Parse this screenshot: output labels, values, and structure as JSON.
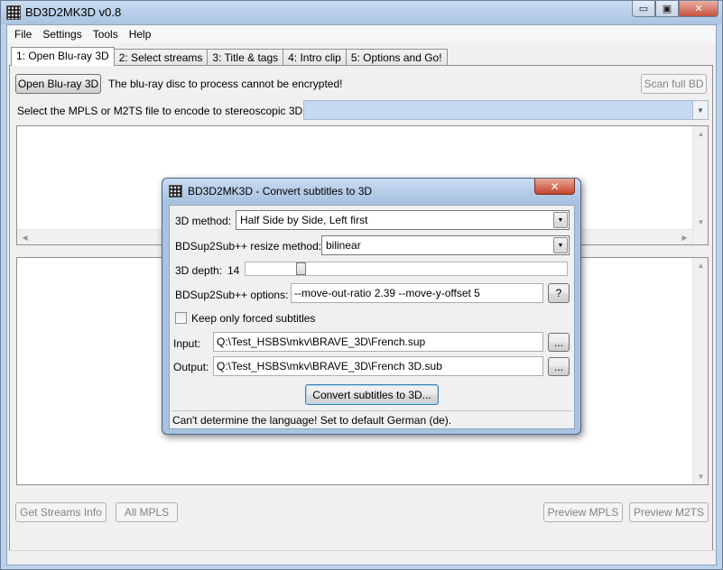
{
  "window": {
    "title": "BD3D2MK3D v0.8",
    "controls": {
      "minimize": "▭",
      "maximize": "▣",
      "close": "✕"
    }
  },
  "menu": [
    "File",
    "Settings",
    "Tools",
    "Help"
  ],
  "tabs": [
    "1: Open Blu-ray 3D",
    "2: Select streams",
    "3: Title & tags",
    "4: Intro clip",
    "5: Options and Go!"
  ],
  "panel": {
    "open_button": "Open Blu-ray 3D",
    "encryption_message": "The blu-ray disc to process cannot be encrypted!",
    "scan_button": "Scan full BD",
    "select_label": "Select the MPLS or M2TS file to encode to stereoscopic 3D:",
    "select_value": "",
    "get_streams_button": "Get Streams Info",
    "all_mpls_button": "All MPLS",
    "preview_mpls_button": "Preview MPLS",
    "preview_m2ts_button": "Preview M2TS"
  },
  "dialog": {
    "title": "BD3D2MK3D - Convert subtitles to 3D",
    "close": "✕",
    "method_label": "3D method:",
    "method_value": "Half Side by Side, Left first",
    "resize_label": "BDSup2Sub++ resize method:",
    "resize_value": "bilinear",
    "depth_label": "3D depth:",
    "depth_value": "14",
    "depth_fraction": 0.14,
    "options_label": "BDSup2Sub++ options:",
    "options_value": "--move-out-ratio 2.39 --move-y-offset 5",
    "help_button": "?",
    "forced_label": "Keep only forced subtitles",
    "forced_checked": false,
    "input_label": "Input:",
    "input_value": "Q:\\Test_HSBS\\mkv\\BRAVE_3D\\French.sup",
    "output_label": "Output:",
    "output_value": "Q:\\Test_HSBS\\mkv\\BRAVE_3D\\French 3D.sub",
    "browse_button": "...",
    "convert_button": "Convert subtitles to 3D...",
    "status": "Can't determine the language!  Set to default German (de)."
  }
}
